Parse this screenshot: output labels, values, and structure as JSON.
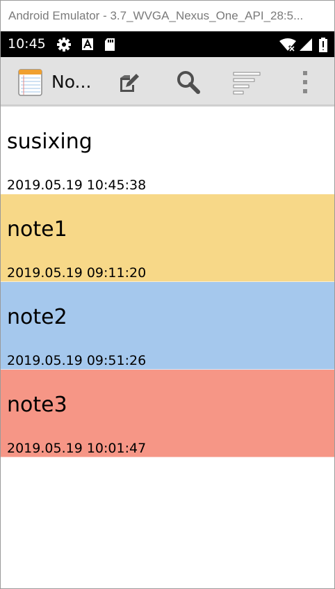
{
  "window": {
    "title": "Android Emulator - 3.7_WVGA_Nexus_One_API_28:5..."
  },
  "statusbar": {
    "time": "10:45",
    "icons": [
      "gear-icon",
      "a-icon",
      "sd-card-icon",
      "wifi-icon",
      "signal-icon",
      "battery-icon"
    ]
  },
  "actionbar": {
    "app_title": "No...",
    "actions": [
      "new-note-icon",
      "search-icon",
      "sort-icon",
      "overflow-menu-icon"
    ]
  },
  "notes": [
    {
      "title": "susixing",
      "date": "2019.05.19 10:45:38",
      "color": "#ffffff"
    },
    {
      "title": "note1",
      "date": "2019.05.19 09:11:20",
      "color": "#f7d888"
    },
    {
      "title": "note2",
      "date": "2019.05.19 09:51:26",
      "color": "#a5c8ed"
    },
    {
      "title": "note3",
      "date": "2019.05.19 10:01:47",
      "color": "#f69686"
    }
  ]
}
